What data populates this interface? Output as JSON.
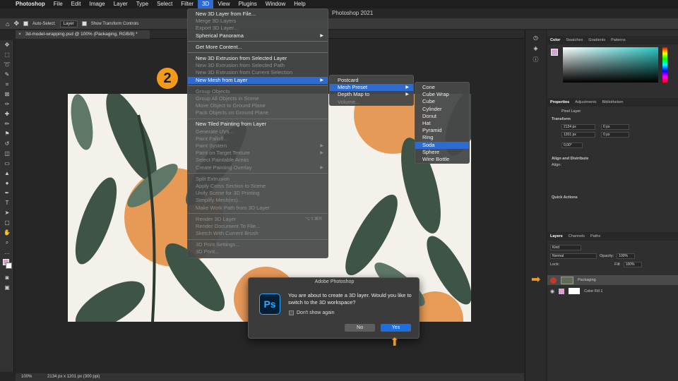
{
  "menubar": {
    "app": "Photoshop",
    "items": [
      "File",
      "Edit",
      "Image",
      "Layer",
      "Type",
      "Select",
      "Filter",
      "3D",
      "View",
      "Plugins",
      "Window",
      "Help"
    ],
    "active": "3D"
  },
  "window_title": "Photoshop 2021",
  "options": {
    "auto_select_label": "Auto-Select:",
    "auto_select_value": "Layer",
    "show_transform": "Show Transform Controls"
  },
  "document_tab": "3d-model-wrapping.psd @ 100% (Packaging, RGB/8) *",
  "status": {
    "zoom": "100%",
    "info": "2134 px x 1201 px (300 ppi)"
  },
  "menu_3d": {
    "items": [
      {
        "label": "New 3D Layer from File...",
        "state": "enabled"
      },
      {
        "label": "Merge 3D Layers",
        "state": "disabled"
      },
      {
        "label": "Export 3D Layer...",
        "state": "disabled"
      },
      {
        "label": "Spherical Panorama",
        "state": "enabled",
        "submenu": true
      },
      {
        "sep": true
      },
      {
        "label": "Get More Content...",
        "state": "enabled"
      },
      {
        "sep": true
      },
      {
        "label": "New 3D Extrusion from Selected Layer",
        "state": "enabled"
      },
      {
        "label": "New 3D Extrusion from Selected Path",
        "state": "disabled"
      },
      {
        "label": "New 3D Extrusion from Current Selection",
        "state": "disabled"
      },
      {
        "label": "New Mesh from Layer",
        "state": "highlighted",
        "submenu": true
      },
      {
        "sep": true
      },
      {
        "label": "Group Objects",
        "state": "disabled"
      },
      {
        "label": "Group All Objects in Scene",
        "state": "disabled"
      },
      {
        "label": "Move Object to Ground Plane",
        "state": "disabled"
      },
      {
        "label": "Pack Objects on Ground Plane",
        "state": "disabled"
      },
      {
        "sep": true
      },
      {
        "label": "New Tiled Painting from Layer",
        "state": "enabled"
      },
      {
        "label": "Generate UVs...",
        "state": "disabled"
      },
      {
        "label": "Paint Falloff...",
        "state": "disabled"
      },
      {
        "label": "Paint System",
        "state": "disabled",
        "submenu": true
      },
      {
        "label": "Paint on Target Texture",
        "state": "disabled",
        "submenu": true
      },
      {
        "label": "Select Paintable Areas",
        "state": "disabled"
      },
      {
        "label": "Create Painting Overlay",
        "state": "disabled",
        "submenu": true
      },
      {
        "sep": true
      },
      {
        "label": "Split Extrusion",
        "state": "disabled"
      },
      {
        "label": "Apply Cross Section to Scene",
        "state": "disabled"
      },
      {
        "label": "Unify Scene for 3D Printing",
        "state": "disabled"
      },
      {
        "label": "Simplify Mesh(es)...",
        "state": "disabled"
      },
      {
        "label": "Make Work Path from 3D Layer",
        "state": "disabled"
      },
      {
        "sep": true
      },
      {
        "label": "Render 3D Layer",
        "state": "disabled",
        "shortcut": "⌥⇧⌘R"
      },
      {
        "label": "Render Document To File...",
        "state": "disabled"
      },
      {
        "label": "Sketch With Current Brush",
        "state": "disabled"
      },
      {
        "sep": true
      },
      {
        "label": "3D Print Settings...",
        "state": "disabled"
      },
      {
        "label": "3D Print...",
        "state": "disabled"
      }
    ]
  },
  "submenu_mesh": {
    "items": [
      {
        "label": "Postcard",
        "state": "enabled"
      },
      {
        "label": "Mesh Preset",
        "state": "highlighted",
        "submenu": true
      },
      {
        "label": "Depth Map to",
        "state": "enabled",
        "submenu": true
      },
      {
        "label": "Volume...",
        "state": "disabled"
      }
    ]
  },
  "submenu_preset": {
    "items": [
      "Cone",
      "Cube Wrap",
      "Cube",
      "Cylinder",
      "Donut",
      "Hat",
      "Pyramid",
      "Ring",
      "Soda",
      "Sphere",
      "Wine Bottle"
    ],
    "selected": "Soda"
  },
  "step_badge": "2",
  "dialog": {
    "title": "Adobe Photoshop",
    "icon_text": "Ps",
    "message": "You are about to create a 3D layer.  Would you like to switch to the 3D workspace?",
    "checkbox": "Don't show again",
    "no": "No",
    "yes": "Yes"
  },
  "panels": {
    "color_tabs": [
      "Color",
      "Swatches",
      "Gradients",
      "Patterns"
    ],
    "props_tabs": [
      "Properties",
      "Adjustments",
      "Bibliotheken"
    ],
    "pixel_layer": "Pixel Layer",
    "transform": "Transform",
    "w": "2134 px",
    "h": "1201 px",
    "x": "0 px",
    "y": "0 px",
    "angle": "0,00°",
    "align": "Align and Distribute",
    "align_sub": "Align:",
    "quick": "Quick Actions",
    "layers_tabs": [
      "Layers",
      "Channels",
      "Paths"
    ],
    "kind": "Kind",
    "blend": "Normal",
    "opacity_label": "Opacity:",
    "opacity": "100%",
    "lock_label": "Lock:",
    "fill_label": "Fill:",
    "fill": "100%",
    "layers": [
      "Packaging",
      "Color Fill 1"
    ]
  },
  "colors": {
    "accent": "#2d6bd1",
    "badge": "#f39a1e",
    "swatch_fg": "#d9a3cf"
  }
}
